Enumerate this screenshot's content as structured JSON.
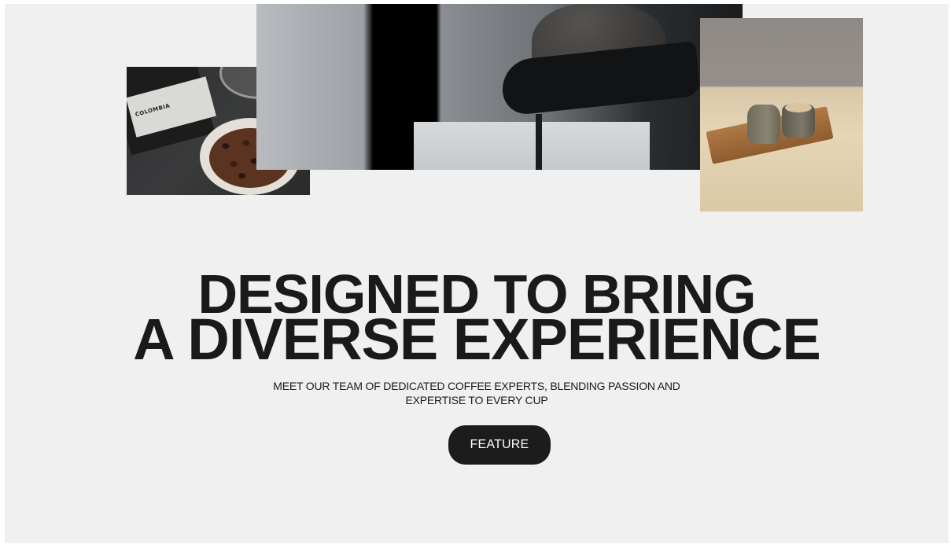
{
  "hero": {
    "headline_line1": "DESIGNED TO BRING",
    "headline_line2": "A DIVERSE EXPERIENCE",
    "subtitle_line1": "MEET OUR TEAM OF DEDICATED COFFEE EXPERTS, BLENDING PASSION AND",
    "subtitle_line2": "EXPERTISE TO EVERY CUP",
    "cta_label": "FEATURE"
  },
  "images": {
    "left_label_text": "COLOMBIA"
  },
  "colors": {
    "background": "#eff0ef",
    "text": "#1a1a1a",
    "button_bg": "#1c1c1c",
    "button_text": "#ffffff"
  }
}
